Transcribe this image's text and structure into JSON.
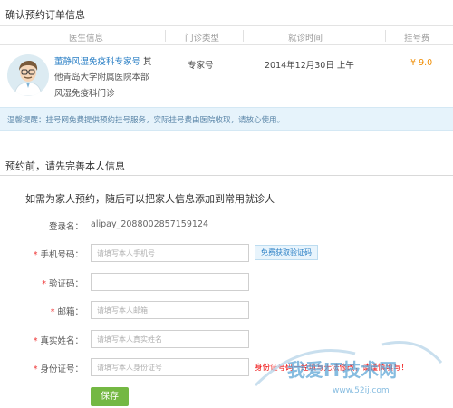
{
  "order": {
    "title": "确认预约订单信息",
    "columns": [
      "医生信息",
      "门诊类型",
      "就诊时间",
      "挂号费"
    ],
    "doctor": {
      "name": "董静风湿免疫科专家号",
      "name_suffix": "其",
      "affiliation_line1": "他",
      "affiliation": "青岛大学附属医院本部",
      "department": "风湿免疫科门诊"
    },
    "clinic_type": "专家号",
    "visit_time": "2014年12月30日 上午",
    "fee": "¥ 9.0"
  },
  "notice": "温馨提醒：挂号网免费提供预约挂号服务，实际挂号费由医院收取，请放心使用。",
  "patient": {
    "title": "预约前，请先完善本人信息",
    "hint": "如需为家人预约，随后可以把家人信息添加到常用就诊人",
    "login_label": "登录名：",
    "login_value": "alipay_2088002857159124",
    "fields": {
      "phone": {
        "label": "手机号码：",
        "placeholder": "请填写本人手机号"
      },
      "code": {
        "label": "验证码：",
        "placeholder": ""
      },
      "email": {
        "label": "邮箱：",
        "placeholder": "请填写本人邮箱"
      },
      "realname": {
        "label": "真实姓名：",
        "placeholder": "请填写本人真实姓名"
      },
      "idcard": {
        "label": "身份证号：",
        "placeholder": "请填写本人身份证号"
      }
    },
    "get_code_button": "免费获取验证码",
    "id_error": "身份证号码一经填写无法修改，请谨慎填写！",
    "save_button": "保存"
  },
  "watermark": {
    "text": "我爱IT技术网",
    "url": "www.52ij.com"
  },
  "colors": {
    "link": "#2a7fc5",
    "fee": "#f08c00",
    "save": "#74b843",
    "error": "#e00000",
    "notice_bg": "#e6f3fb"
  }
}
